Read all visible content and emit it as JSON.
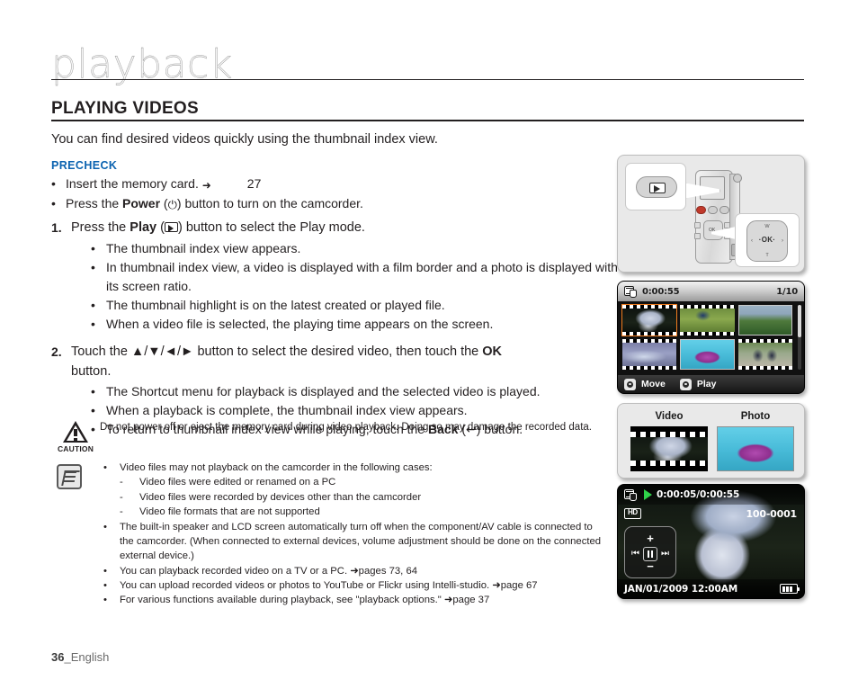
{
  "page": {
    "chapter": "playback",
    "section_title": "PLAYING VIDEOS",
    "intro": "You can find desired videos quickly using the thumbnail index view.",
    "footer_number": "36",
    "footer_language": "_English",
    "accent_color": "#0b63b0",
    "highlight_color": "#f07c1e"
  },
  "precheck": {
    "heading": "PRECHECK",
    "items": [
      {
        "text_before": "Insert the memory card.",
        "arrow": "➜",
        "page_ref": "27"
      },
      {
        "text_before": "Press the ",
        "bold": "Power",
        "icon": "power-icon",
        "text_after": ") button to turn on the camcorder."
      }
    ]
  },
  "steps": [
    {
      "num": "1.",
      "lead_before": "Press the ",
      "lead_bold": "Play",
      "lead_icon": "play-icon",
      "lead_after": ") button to select the Play mode.",
      "subs": [
        "The thumbnail index view appears.",
        "In thumbnail index view, a video is displayed with a film border and a photo is displayed with its screen ratio.",
        "The thumbnail highlight is on the latest created or played file.",
        "When a video file is selected, the playing time appears on the screen."
      ]
    },
    {
      "num": "2.",
      "lead_before": "Touch the ",
      "lead_keys": "▲/▼/◄/►",
      "lead_mid": " button to select the desired video, then touch the ",
      "lead_bold": "OK",
      "lead_after": "button.",
      "subs": [
        "The Shortcut menu for playback is displayed and the selected video is played.",
        "When a playback is complete, the thumbnail index view appears.",
        "To return to thumbnail index view while playing, touch the "
      ],
      "sub3_bold": "Back",
      "sub3_icon": "back-arrow-icon",
      "sub3_after": ") button."
    }
  ],
  "caution": {
    "label": "CAUTION",
    "icon": "warning-triangle-icon",
    "text": "Do not power off or eject the memory card during video playback. Doing so may damage the recorded data."
  },
  "notes": {
    "icon": "note-pencil-icon",
    "items": [
      {
        "text": "Video files may not playback on the camcorder in the following cases:",
        "dashes": [
          "Video files were edited or renamed on a PC",
          "Video files were recorded by devices other than the camcorder",
          "Video file formats that are not supported"
        ]
      },
      {
        "text": "The built-in speaker and LCD screen automatically turn off when the component/AV cable is connected to the camcorder. (When connected to external devices, volume adjustment should be done on the connected external device.)"
      },
      {
        "text": "You can playback recorded video on a TV or a PC. ➜pages 73, 64"
      },
      {
        "text": "You can upload recorded videos or photos to YouTube or Flickr using Intelli-studio. ➜page 67"
      },
      {
        "text": "For various functions available during playback, see \"playback options.\" ➜page 37"
      }
    ]
  },
  "figures": {
    "camcorder": {
      "name": "camcorder-diagram",
      "play_button_icon": "play-button-callout",
      "ok_pad": {
        "center": "·OK·",
        "top": "W",
        "bottom": "T",
        "left": "‹",
        "right": "›"
      }
    },
    "thumbnail_index": {
      "mode_icon": "video-playback-mode-icon",
      "duration": "0:00:55",
      "counter": "1/10",
      "thumbnails": [
        {
          "type": "video",
          "selected": true,
          "image": "img-umbrella"
        },
        {
          "type": "video",
          "selected": false,
          "image": "img-field"
        },
        {
          "type": "photo",
          "selected": false,
          "image": "img-forest"
        },
        {
          "type": "video",
          "selected": false,
          "image": "img-water"
        },
        {
          "type": "photo",
          "selected": false,
          "image": "img-pool"
        },
        {
          "type": "video",
          "selected": false,
          "image": "img-skaters"
        }
      ],
      "move_label": "Move",
      "play_label": "Play"
    },
    "video_photo": {
      "video_label": "Video",
      "photo_label": "Photo"
    },
    "playback_screen": {
      "mode_icon": "video-playback-mode-icon",
      "play_icon": "play-triangle-icon",
      "time": "0:00:05/0:00:55",
      "quality_badge": "HD",
      "file_number": "100-0001",
      "date": "JAN/01/2009 12:00AM",
      "battery_icon": "battery-full-icon",
      "shortcut": {
        "volume_up": "+",
        "volume_down": "−",
        "previous": "⏮",
        "pause": "pause-icon",
        "next": "⏭"
      }
    }
  }
}
